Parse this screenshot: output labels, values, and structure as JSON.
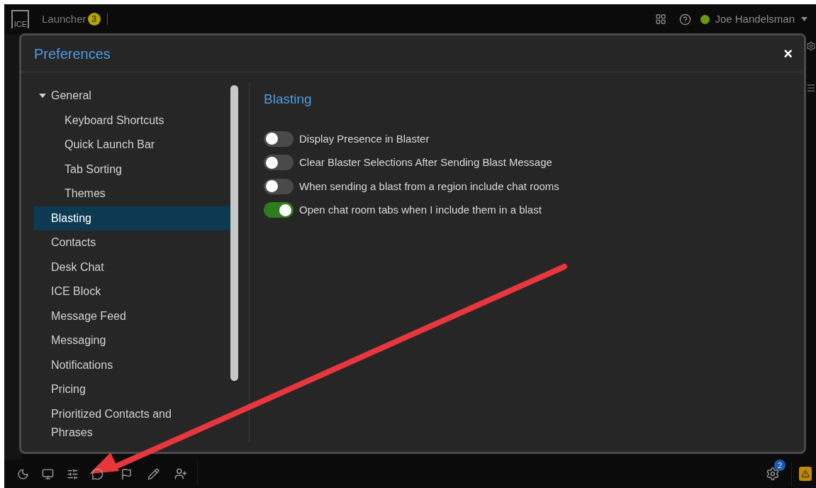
{
  "top_bar": {
    "logo": "ICE",
    "launcher": {
      "label": "Launcher",
      "badge": "3"
    },
    "user": {
      "name": "Joe Handelsman",
      "online": true
    }
  },
  "dialog": {
    "title": "Preferences",
    "close": "×",
    "nav": [
      {
        "label": "General",
        "selected": false,
        "expanded": true,
        "children": [
          {
            "label": "Keyboard Shortcuts",
            "selected": false
          },
          {
            "label": "Quick Launch Bar",
            "selected": false
          },
          {
            "label": "Tab Sorting",
            "selected": false
          },
          {
            "label": "Themes",
            "selected": false
          }
        ]
      },
      {
        "label": "Blasting",
        "selected": true
      },
      {
        "label": "Contacts",
        "selected": false
      },
      {
        "label": "Desk Chat",
        "selected": false
      },
      {
        "label": "ICE Block",
        "selected": false
      },
      {
        "label": "Message Feed",
        "selected": false
      },
      {
        "label": "Messaging",
        "selected": false
      },
      {
        "label": "Notifications",
        "selected": false
      },
      {
        "label": "Pricing",
        "selected": false
      },
      {
        "label": "Prioritized Contacts and Phrases",
        "selected": false
      }
    ],
    "section": {
      "title": "Blasting",
      "settings": [
        {
          "label": "Display Presence in Blaster",
          "on": false
        },
        {
          "label": "Clear Blaster Selections After Sending Blast Message",
          "on": false
        },
        {
          "label": "When sending a blast from a region include chat rooms",
          "on": false
        },
        {
          "label": "Open chat room tabs when I include them in a blast",
          "on": true
        }
      ]
    }
  },
  "bottom_bar": {
    "alerts_badge": "2"
  }
}
